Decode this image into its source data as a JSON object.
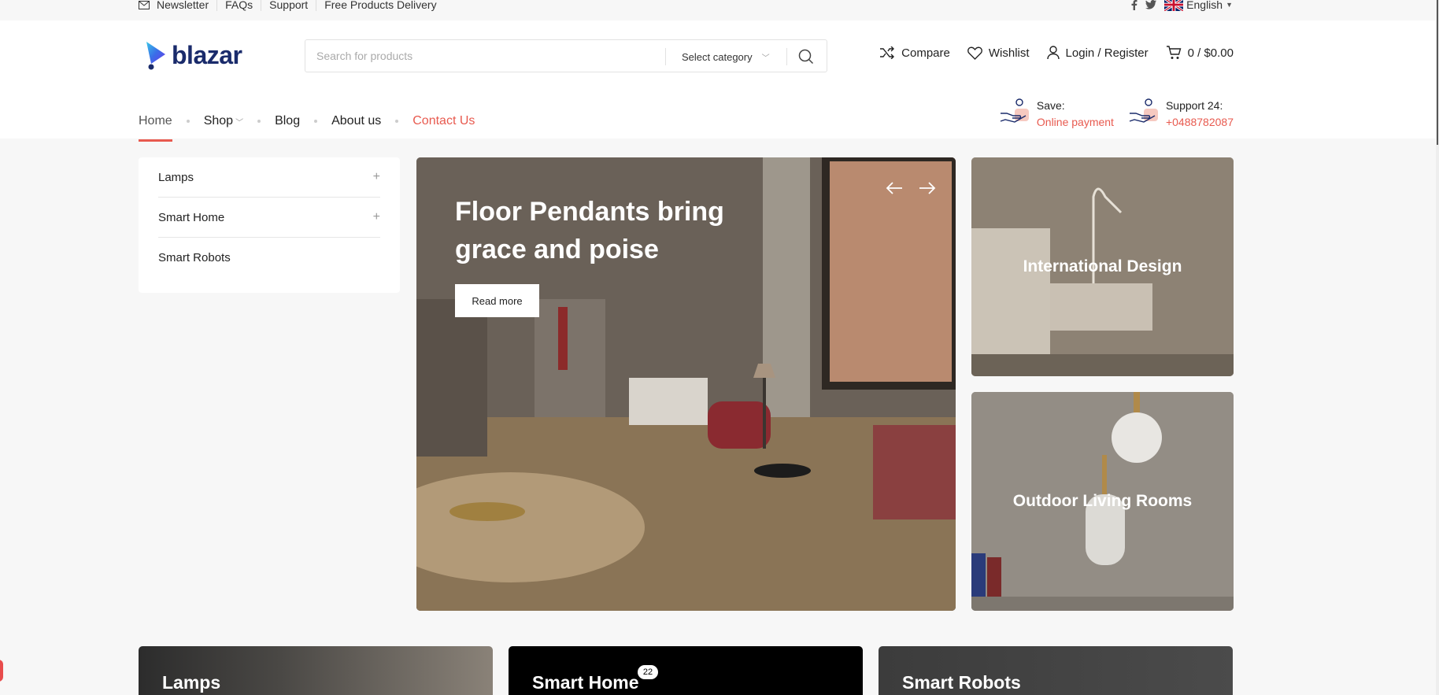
{
  "topbar": {
    "links": [
      "Newsletter",
      "FAQs",
      "Support",
      "Free Products Delivery"
    ],
    "language": "English",
    "social_icons": [
      "facebook-icon",
      "twitter-icon"
    ]
  },
  "header": {
    "logo_text": "blazar",
    "search": {
      "placeholder": "Search for products",
      "category": "Select category"
    },
    "actions": {
      "compare": "Compare",
      "wishlist": "Wishlist",
      "login": "Login / Register",
      "cart": "0 / $0.00"
    }
  },
  "nav": {
    "items": [
      "Home",
      "Shop",
      "Blog",
      "About us",
      "Contact Us"
    ]
  },
  "promos": [
    {
      "label": "Save:",
      "value": "Online payment"
    },
    {
      "label": "Support 24:",
      "value": "+0488782087"
    }
  ],
  "sidebar": {
    "items": [
      "Lamps",
      "Smart Home",
      "Smart Robots"
    ]
  },
  "hero": {
    "title": "Floor Pendants bring grace and poise",
    "button": "Read more"
  },
  "cards": {
    "international": "International Design",
    "outdoor": "Outdoor Living Rooms"
  },
  "categories": [
    {
      "name": "Lamps"
    },
    {
      "name": "Smart Home",
      "badge": "22"
    },
    {
      "name": "Smart Robots"
    }
  ],
  "colors": {
    "accent": "#e85a4f",
    "logo": "#1a2b6b"
  }
}
